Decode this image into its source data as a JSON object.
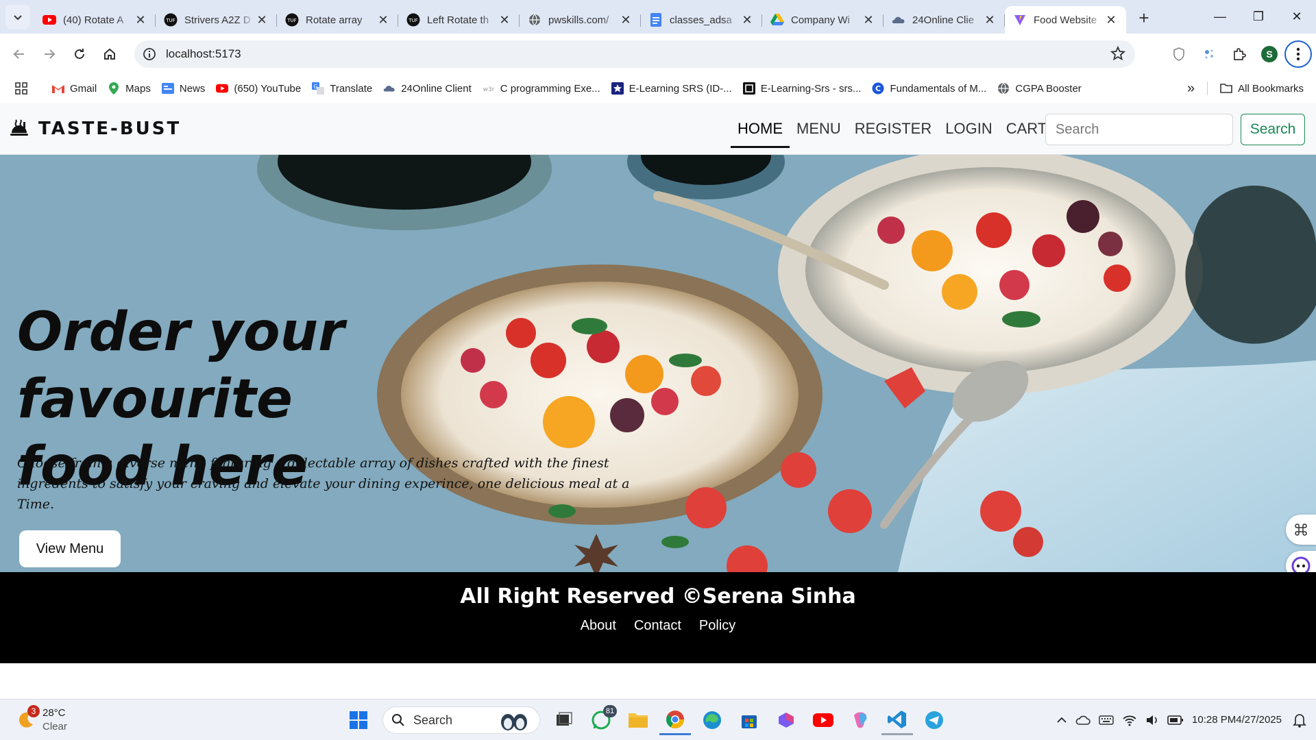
{
  "browser": {
    "tabs": [
      {
        "title": "(40) Rotate A",
        "icon": "youtube-icon",
        "active": false
      },
      {
        "title": "Strivers A2Z D",
        "icon": "tuf-icon",
        "active": false
      },
      {
        "title": "Rotate array",
        "icon": "tuf-icon",
        "active": false
      },
      {
        "title": "Left Rotate th",
        "icon": "tuf-icon",
        "active": false
      },
      {
        "title": "pwskills.com/",
        "icon": "globe-icon",
        "active": false
      },
      {
        "title": "classes_adsa",
        "icon": "docs-icon",
        "active": false
      },
      {
        "title": "Company Wi",
        "icon": "drive-icon",
        "active": false
      },
      {
        "title": "24Online Clie",
        "icon": "cloud-icon",
        "active": false
      },
      {
        "title": "Food Website",
        "icon": "vite-icon",
        "active": true
      }
    ],
    "url": "localhost:5173",
    "profile_initial": "S",
    "bookmarks": [
      {
        "label": "Gmail",
        "icon": "gmail-icon"
      },
      {
        "label": "Maps",
        "icon": "maps-icon"
      },
      {
        "label": "News",
        "icon": "news-icon"
      },
      {
        "label": "(650) YouTube",
        "icon": "youtube-icon"
      },
      {
        "label": "Translate",
        "icon": "translate-icon"
      },
      {
        "label": "24Online Client",
        "icon": "cloud-icon"
      },
      {
        "label": "C programming Exe...",
        "icon": "w3r-icon"
      },
      {
        "label": "E-Learning SRS (ID-...",
        "icon": "star-badge-icon"
      },
      {
        "label": "E-Learning-Srs - srs...",
        "icon": "srs-icon"
      },
      {
        "label": "Fundamentals of M...",
        "icon": "c-icon"
      },
      {
        "label": "CGPA Booster",
        "icon": "globe-icon"
      }
    ],
    "all_bookmarks_label": "All Bookmarks"
  },
  "site": {
    "brand": "TASTE-BUST",
    "nav": [
      {
        "label": "HOME",
        "active": true
      },
      {
        "label": "MENU",
        "active": false
      },
      {
        "label": "REGISTER",
        "active": false
      },
      {
        "label": "LOGIN",
        "active": false
      },
      {
        "label": "CART",
        "active": false
      }
    ],
    "search_placeholder": "Search",
    "search_button": "Search",
    "hero": {
      "title_line1": "Order your favourite",
      "title_line2": "food here",
      "description": "Choose from a diverse menu featuring a delectable array of dishes crafted with the finest ingredents to satisfy your craving and elevate your dining experince, one delicious meal at a Time.",
      "cta": "View Menu"
    },
    "footer": {
      "copyright": "All Right Reserved ©Serena Sinha",
      "links": [
        "About",
        "Contact",
        "Policy"
      ]
    }
  },
  "taskbar": {
    "weather_temp": "28°C",
    "weather_cond": "Clear",
    "weather_badge": "3",
    "search_label": "Search",
    "whatsapp_badge": "81",
    "time": "10:28 PM",
    "date": "4/27/2025"
  },
  "colors": {
    "accent_green": "#198754",
    "tab_strip": "#dfe6f4",
    "footer_bg": "#000000"
  }
}
